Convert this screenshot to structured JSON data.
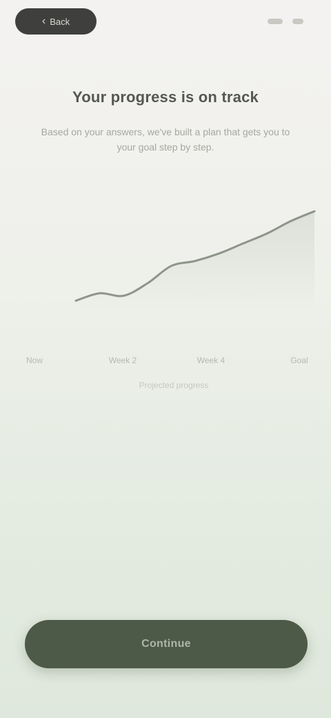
{
  "top_bar": {
    "back_label": "Back"
  },
  "headline": {
    "title": "Your progress is on track",
    "subtitle": "Based on your answers, we've built a plan that gets you to your goal step by step."
  },
  "chart_data": {
    "type": "area",
    "x": [
      0,
      1,
      2,
      3,
      4,
      5,
      6,
      7,
      8,
      9,
      10
    ],
    "values": [
      8,
      14,
      12,
      22,
      36,
      40,
      46,
      54,
      62,
      72,
      80
    ],
    "ylim": [
      0,
      100
    ],
    "tick_labels": [
      "Now",
      "Week 2",
      "Week 4",
      "Goal"
    ],
    "caption": "Projected progress",
    "grid": false,
    "colors": {
      "line": "#8e9489",
      "fill": "#d7dcd3"
    }
  },
  "cta": {
    "label": "Continue"
  },
  "colors": {
    "accent": "#4d5a48",
    "back_pill": "#3f403d"
  }
}
